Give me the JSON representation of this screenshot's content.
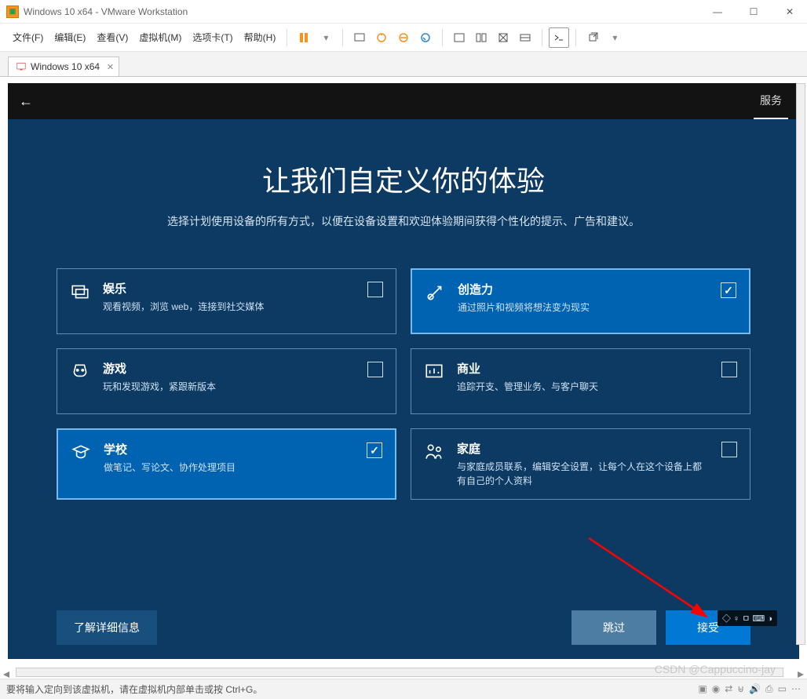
{
  "window": {
    "title": "Windows 10 x64 - VMware Workstation",
    "min": "—",
    "max": "☐",
    "close": "✕"
  },
  "menus": {
    "file": "文件(F)",
    "edit": "编辑(E)",
    "view": "查看(V)",
    "vm": "虚拟机(M)",
    "tabs": "选项卡(T)",
    "help": "帮助(H)"
  },
  "tab": {
    "label": "Windows 10 x64",
    "close": "✕"
  },
  "vm": {
    "topbar": {
      "services": "服务"
    },
    "oobe": {
      "heading": "让我们自定义你的体验",
      "sub": "选择计划使用设备的所有方式，以便在设备设置和欢迎体验期间获得个性化的提示、广告和建议。",
      "tiles": [
        {
          "id": "entertainment",
          "title": "娱乐",
          "desc": "观看视频，浏览 web，连接到社交媒体",
          "selected": false
        },
        {
          "id": "creativity",
          "title": "创造力",
          "desc": "通过照片和视频将想法变为现实",
          "selected": true
        },
        {
          "id": "gaming",
          "title": "游戏",
          "desc": "玩和发现游戏，紧跟新版本",
          "selected": false
        },
        {
          "id": "business",
          "title": "商业",
          "desc": "追踪开支、管理业务、与客户聊天",
          "selected": false
        },
        {
          "id": "school",
          "title": "学校",
          "desc": "做笔记、写论文、协作处理项目",
          "selected": true
        },
        {
          "id": "family",
          "title": "家庭",
          "desc": "与家庭成员联系，编辑安全设置，让每个人在这个设备上都有自己的个人资料",
          "selected": false
        }
      ],
      "footer": {
        "learn_more": "了解详细信息",
        "skip": "跳过",
        "accept": "接受"
      }
    }
  },
  "status": {
    "hint": "要将输入定向到该虚拟机，请在虚拟机内部单击或按 Ctrl+G。"
  },
  "watermark": "CSDN @Cappuccino-jay"
}
